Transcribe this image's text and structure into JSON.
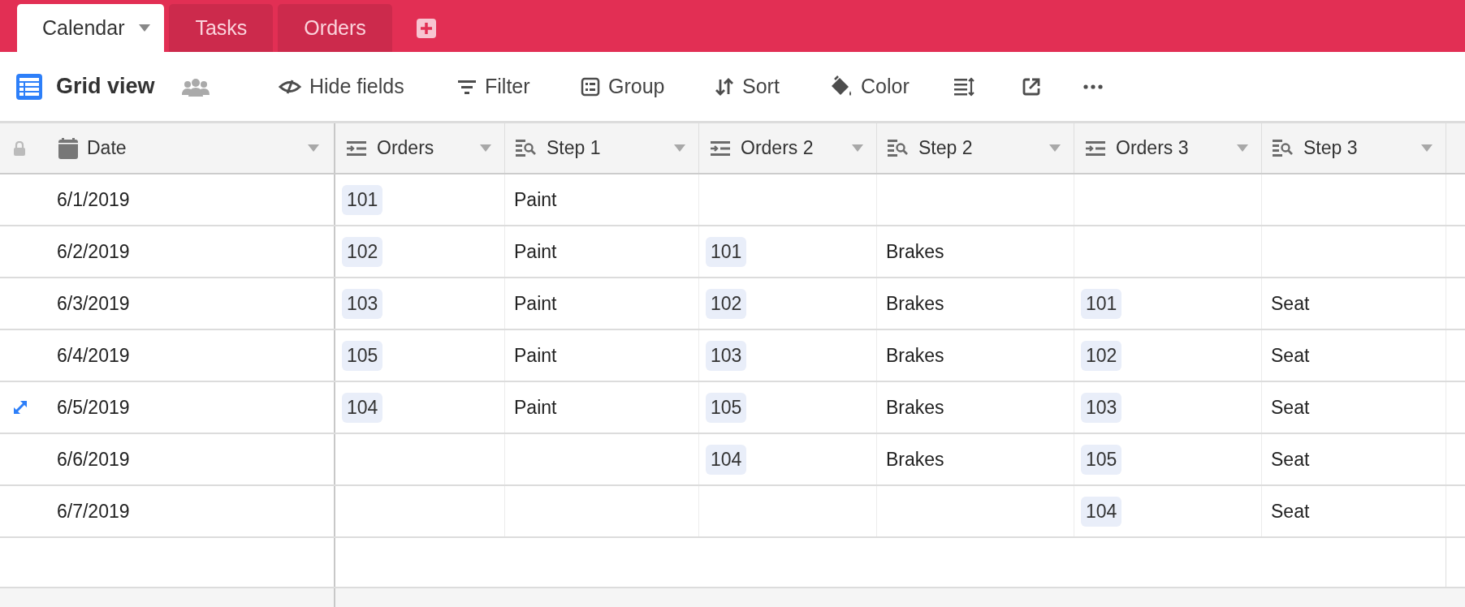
{
  "tabs": [
    {
      "label": "Calendar",
      "selected": true
    },
    {
      "label": "Tasks",
      "selected": false
    },
    {
      "label": "Orders",
      "selected": false
    }
  ],
  "view": {
    "name": "Grid view"
  },
  "toolbar": [
    {
      "kind": "hide",
      "label": "Hide fields"
    },
    {
      "kind": "filter",
      "label": "Filter"
    },
    {
      "kind": "group",
      "label": "Group"
    },
    {
      "kind": "sort",
      "label": "Sort"
    },
    {
      "kind": "color",
      "label": "Color"
    },
    {
      "kind": "height"
    },
    {
      "kind": "share"
    },
    {
      "kind": "more"
    }
  ],
  "columns": [
    {
      "name": "Date",
      "kind": "date"
    },
    {
      "name": "Orders",
      "kind": "link"
    },
    {
      "name": "Step 1",
      "kind": "lookup"
    },
    {
      "name": "Orders 2",
      "kind": "link"
    },
    {
      "name": "Step 2",
      "kind": "lookup"
    },
    {
      "name": "Orders 3",
      "kind": "link"
    },
    {
      "name": "Step 3",
      "kind": "lookup"
    }
  ],
  "rows": [
    {
      "hovered": false,
      "cells": [
        "6/1/2019",
        "101",
        "Paint",
        null,
        null,
        null,
        null
      ]
    },
    {
      "hovered": false,
      "cells": [
        "6/2/2019",
        "102",
        "Paint",
        "101",
        "Brakes",
        null,
        null
      ]
    },
    {
      "hovered": false,
      "cells": [
        "6/3/2019",
        "103",
        "Paint",
        "102",
        "Brakes",
        "101",
        "Seat"
      ]
    },
    {
      "hovered": false,
      "cells": [
        "6/4/2019",
        "105",
        "Paint",
        "103",
        "Brakes",
        "102",
        "Seat"
      ]
    },
    {
      "hovered": true,
      "cells": [
        "6/5/2019",
        "104",
        "Paint",
        "105",
        "Brakes",
        "103",
        "Seat"
      ]
    },
    {
      "hovered": false,
      "cells": [
        "6/6/2019",
        null,
        null,
        "104",
        "Brakes",
        "105",
        "Seat"
      ]
    },
    {
      "hovered": false,
      "cells": [
        "6/7/2019",
        null,
        null,
        null,
        null,
        "104",
        "Seat"
      ]
    }
  ]
}
